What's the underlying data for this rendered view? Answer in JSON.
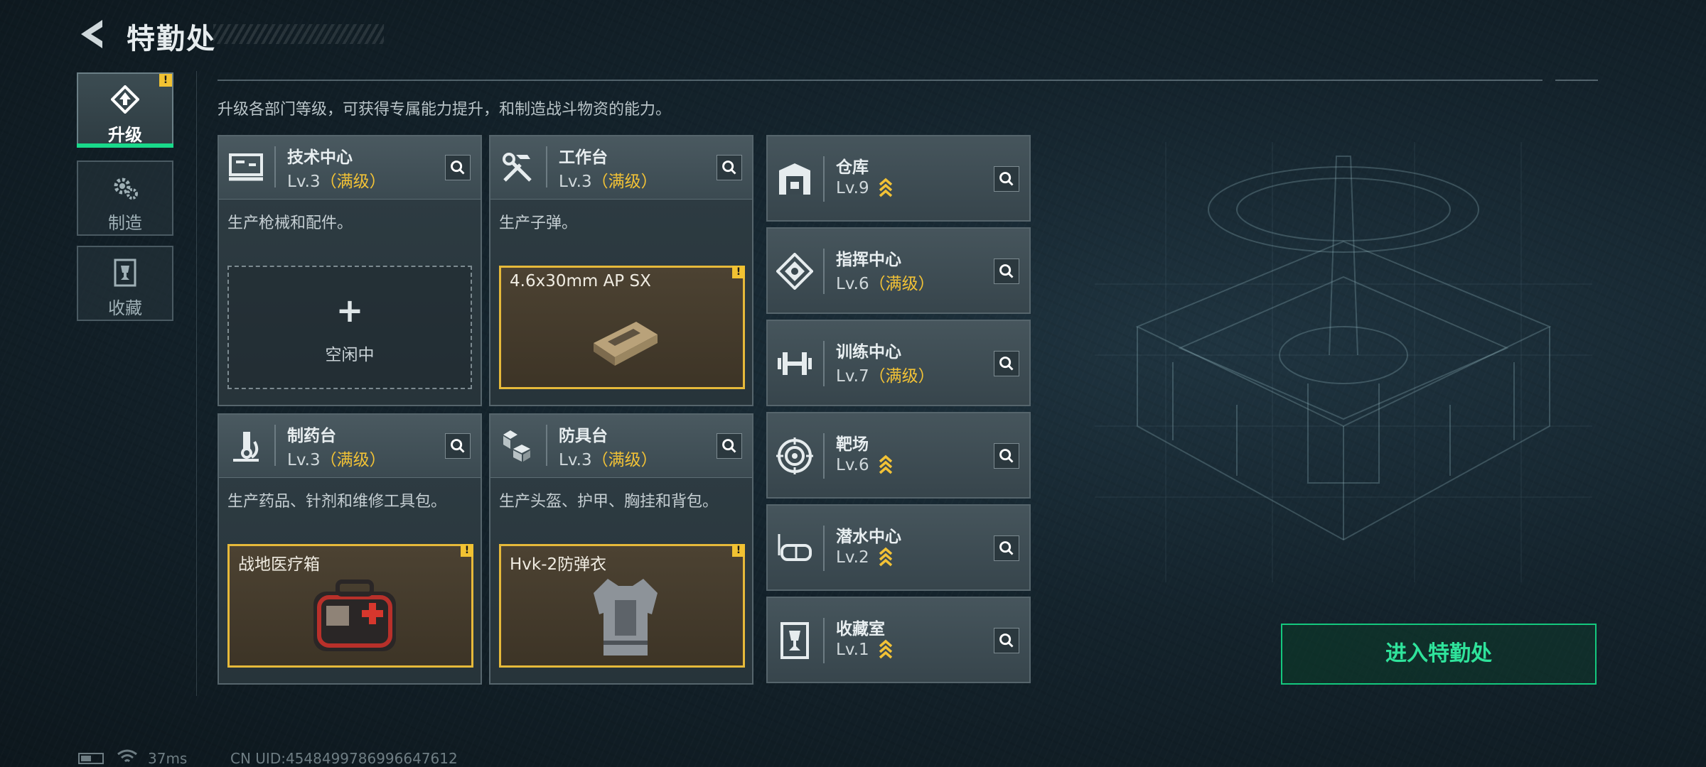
{
  "header": {
    "title": "特勤处"
  },
  "nav": [
    {
      "label": "升级",
      "icon": "upgrade-icon",
      "active": true,
      "warning": "!"
    },
    {
      "label": "制造",
      "icon": "gears-icon",
      "active": false
    },
    {
      "label": "收藏",
      "icon": "trophy-icon",
      "active": false
    }
  ],
  "description": "升级各部门等级，可获得专属能力提升，和制造战斗物资的能力。",
  "cards": [
    {
      "name": "技术中心",
      "level": "Lv.3",
      "max": "（满级）",
      "desc": "生产枪械和配件。",
      "slot": {
        "type": "empty",
        "plus": "+",
        "label": "空闲中"
      }
    },
    {
      "name": "工作台",
      "level": "Lv.3",
      "max": "（满级）",
      "desc": "生产子弹。",
      "slot": {
        "type": "item",
        "label": "4.6x30mm AP SX",
        "warning": "!"
      }
    },
    {
      "name": "制药台",
      "level": "Lv.3",
      "max": "（满级）",
      "desc": "生产药品、针剂和维修工具包。",
      "slot": {
        "type": "item",
        "label": "战地医疗箱",
        "warning": "!"
      }
    },
    {
      "name": "防具台",
      "level": "Lv.3",
      "max": "（满级）",
      "desc": "生产头盔、护甲、胸挂和背包。",
      "slot": {
        "type": "item",
        "label": "Hvk-2防弹衣",
        "warning": "!"
      }
    }
  ],
  "facilities": [
    {
      "name": "仓库",
      "level": "Lv.9",
      "max": "",
      "upgradable": true,
      "icon": "warehouse-icon"
    },
    {
      "name": "指挥中心",
      "level": "Lv.6",
      "max": "（满级）",
      "upgradable": false,
      "icon": "command-center-icon"
    },
    {
      "name": "训练中心",
      "level": "Lv.7",
      "max": "（满级）",
      "upgradable": false,
      "icon": "dumbbell-icon"
    },
    {
      "name": "靶场",
      "level": "Lv.6",
      "max": "",
      "upgradable": true,
      "icon": "target-icon"
    },
    {
      "name": "潜水中心",
      "level": "Lv.2",
      "max": "",
      "upgradable": true,
      "icon": "diving-goggles-icon"
    },
    {
      "name": "收藏室",
      "level": "Lv.1",
      "max": "",
      "upgradable": true,
      "icon": "collection-room-icon"
    }
  ],
  "enter_button": "进入特勤处",
  "status": {
    "ping": "37ms",
    "uid": "CN UID:4548499786996647612"
  },
  "colors": {
    "accent_green": "#19d98a",
    "max_level_yellow": "#f2c236",
    "warning_yellow": "#f1c232"
  }
}
